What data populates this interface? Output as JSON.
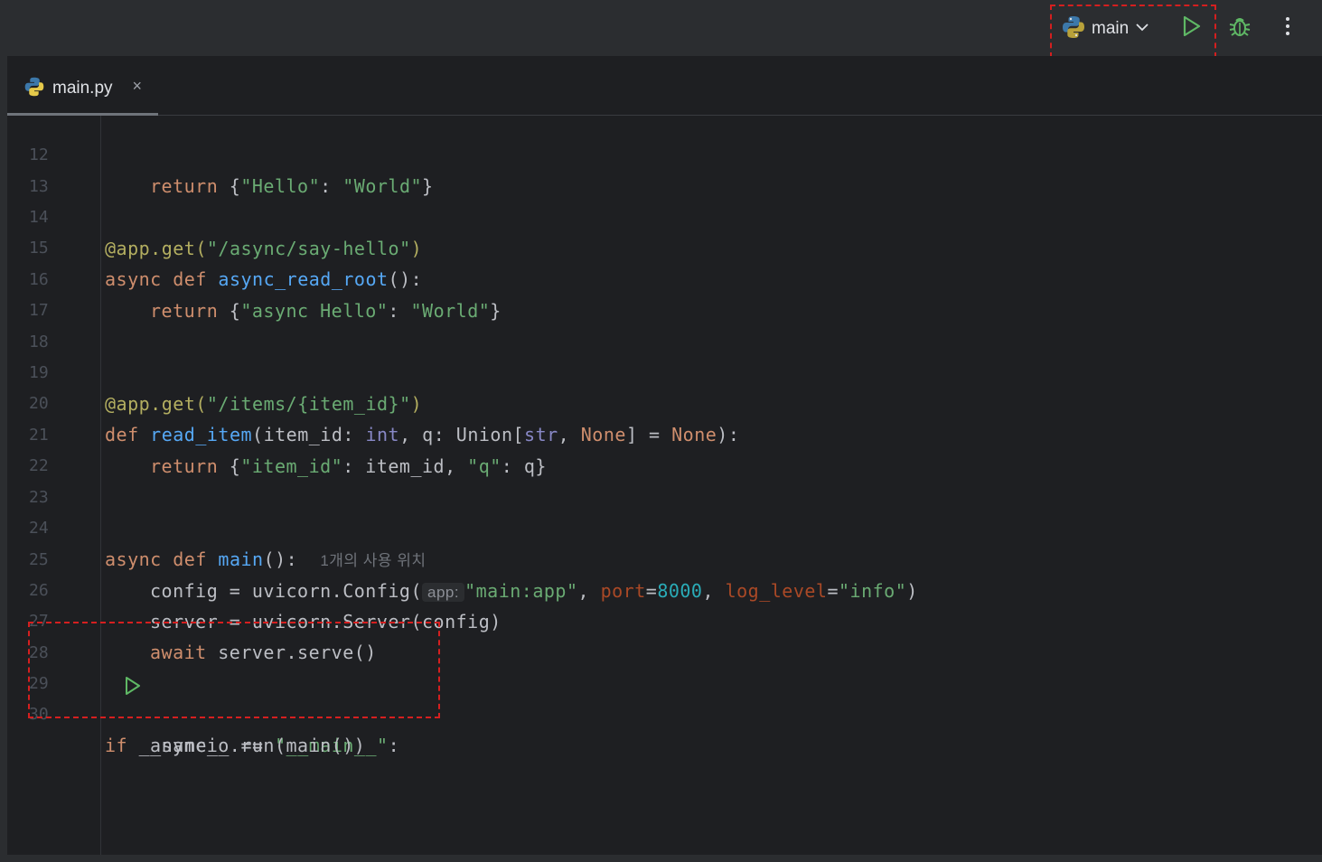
{
  "toolbar": {
    "run_config_label": "main",
    "run_button": "run-icon",
    "debug_button": "debug-icon",
    "more_button": "more-vertical-icon"
  },
  "tab": {
    "label": "main.py",
    "close": "×"
  },
  "editor": {
    "line_numbers": [
      "12",
      "13",
      "14",
      "15",
      "16",
      "17",
      "18",
      "19",
      "20",
      "21",
      "22",
      "23",
      "24",
      "25",
      "26",
      "27",
      "28",
      "29",
      "30"
    ],
    "inline_hint": "1개의 사용 위치",
    "param_hint": "app:",
    "code": {
      "l12": [
        "return",
        " {",
        "\"Hello\"",
        ": ",
        "\"World\"",
        "}"
      ],
      "l14": [
        "@app.get(",
        "\"/async/say-hello\"",
        ")"
      ],
      "l15": [
        "async def",
        " ",
        "async_read_root",
        "():"
      ],
      "l16": [
        "return",
        " {",
        "\"async Hello\"",
        ": ",
        "\"World\"",
        "}"
      ],
      "l19": [
        "@app.get(",
        "\"/items/{item_id}\"",
        ")"
      ],
      "l20": [
        "def",
        " ",
        "read_item",
        "(item_id: ",
        "int",
        ", q: Union[",
        "str",
        ", ",
        "None",
        "] = ",
        "None",
        "):"
      ],
      "l21": [
        "return",
        " {",
        "\"item_id\"",
        ": item_id, ",
        "\"q\"",
        ": q}"
      ],
      "l24": [
        "async def",
        " ",
        "main",
        "():"
      ],
      "l25": [
        "config = uvicorn.Config(",
        "\"main:app\"",
        ", ",
        "port",
        "=",
        "8000",
        ", ",
        "log_level",
        "=",
        "\"info\"",
        ")"
      ],
      "l26": [
        "server = uvicorn.Server(config)"
      ],
      "l27": [
        "await",
        " server.serve()"
      ],
      "l29": [
        "if",
        " __name__ == ",
        "\"__main__\"",
        ":"
      ],
      "l30": [
        "asyncio.run(main())"
      ]
    }
  },
  "colors": {
    "annotation_box": "#d51f1f",
    "keyword": "#cf8e6d",
    "string": "#6aab73",
    "function": "#56a8f5",
    "run_green": "#5fb865"
  }
}
